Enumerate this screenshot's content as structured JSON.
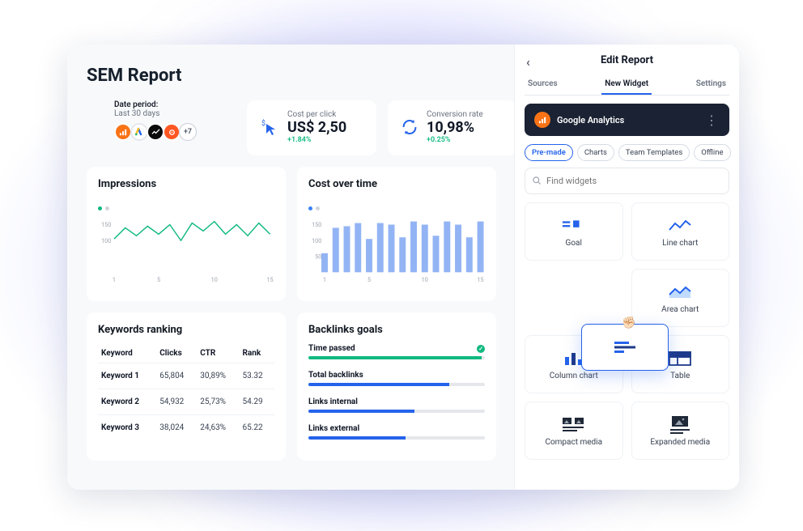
{
  "title": "SEM Report",
  "date_period": {
    "label": "Date period:",
    "value": "Last 30 days",
    "more_badge": "+7"
  },
  "kpis": {
    "cpc": {
      "label": "Cost per click",
      "value": "US$ 2,50",
      "delta": "+1.84%"
    },
    "conv": {
      "label": "Conversion rate",
      "value": "10,98%",
      "delta": "+0.25%"
    }
  },
  "impressions": {
    "title": "Impressions"
  },
  "cost": {
    "title": "Cost over time"
  },
  "keywords": {
    "title": "Keywords ranking",
    "headers": [
      "Keyword",
      "Clicks",
      "CTR",
      "Rank"
    ],
    "rows": [
      {
        "k": "Keyword 1",
        "clicks": "65,804",
        "ctr": "30,89%",
        "rank": "53.32"
      },
      {
        "k": "Keyword 2",
        "clicks": "54,932",
        "ctr": "25,73%",
        "rank": "54.29"
      },
      {
        "k": "Keyword 3",
        "clicks": "38,024",
        "ctr": "24,63%",
        "rank": "65.22"
      }
    ]
  },
  "backlinks": {
    "title": "Backlinks goals",
    "goals": [
      {
        "name": "Time passed",
        "pct": 98,
        "done": true
      },
      {
        "name": "Total backlinks",
        "pct": 80,
        "done": false
      },
      {
        "name": "Links internal",
        "pct": 60,
        "done": false
      },
      {
        "name": "Links external",
        "pct": 55,
        "done": false
      }
    ]
  },
  "side": {
    "title": "Edit Report",
    "tabs": [
      "Sources",
      "New Widget",
      "Settings"
    ],
    "active_tab": 1,
    "source": "Google Analytics",
    "pills": [
      "Pre-made",
      "Charts",
      "Team Templates",
      "Offline"
    ],
    "active_pill": 0,
    "search_placeholder": "Find widgets",
    "widgets": [
      "Goal",
      "Line chart",
      "",
      "Area chart",
      "Column chart",
      "Table",
      "Compact media",
      "Expanded media"
    ]
  },
  "chart_data": [
    {
      "type": "line",
      "title": "Impressions",
      "x": [
        1,
        2,
        3,
        4,
        5,
        6,
        7,
        8,
        9,
        10,
        11,
        12,
        13,
        14,
        15
      ],
      "values": [
        105,
        140,
        115,
        145,
        120,
        150,
        100,
        155,
        130,
        160,
        120,
        150,
        115,
        155,
        120
      ],
      "y_ticks": [
        100,
        150
      ],
      "x_ticks": [
        1,
        5,
        10,
        15
      ]
    },
    {
      "type": "bar",
      "title": "Cost over time",
      "x": [
        1,
        2,
        3,
        4,
        5,
        6,
        7,
        8,
        9,
        10,
        11,
        12,
        13,
        14,
        15
      ],
      "values": [
        60,
        140,
        145,
        155,
        105,
        155,
        150,
        110,
        160,
        150,
        115,
        160,
        150,
        110,
        160
      ],
      "y_ticks": [
        50,
        100,
        150
      ],
      "x_ticks": [
        1,
        5,
        10,
        15
      ]
    }
  ]
}
